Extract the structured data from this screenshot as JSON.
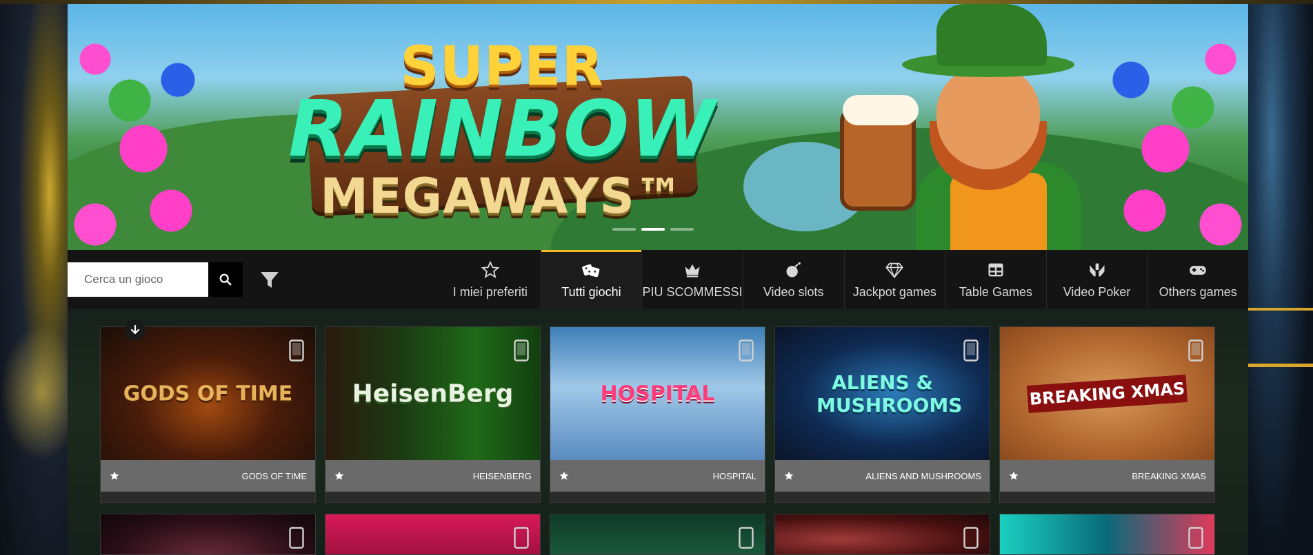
{
  "banner": {
    "logo_line1": "SUPER",
    "logo_line2": "RAINBOW",
    "logo_line3": "MEGAWAYS™"
  },
  "search": {
    "placeholder": "Cerca un gioco"
  },
  "nav": {
    "tabs": [
      {
        "label": "I miei preferiti",
        "icon": "star-icon"
      },
      {
        "label": "Tutti giochi",
        "icon": "dice-icon",
        "active": true
      },
      {
        "label": "PIU SCOMMESSI",
        "icon": "crown-icon"
      },
      {
        "label": "Video slots",
        "icon": "bomb-icon"
      },
      {
        "label": "Jackpot games",
        "icon": "diamond-icon"
      },
      {
        "label": "Table Games",
        "icon": "table-icon"
      },
      {
        "label": "Video Poker",
        "icon": "hands-icon"
      },
      {
        "label": "Others games",
        "icon": "gamepad-icon"
      }
    ]
  },
  "games": [
    {
      "title": "GODS OF TIME",
      "art": "GODS OF TIME"
    },
    {
      "title": "HEISENBERG",
      "art": "HeisenBerg"
    },
    {
      "title": "HOSPITAL",
      "art": "HOSPITAL"
    },
    {
      "title": "ALIENS AND MUSHROOMS",
      "art": "ALIENS & MUSHROOMS"
    },
    {
      "title": "BREAKING XMAS",
      "art": "BREAKING XMAS"
    }
  ],
  "colors": {
    "accent": "#f2b824",
    "toolbar_bg": "#141414",
    "card_meta_bg": "#6a6a6a"
  }
}
